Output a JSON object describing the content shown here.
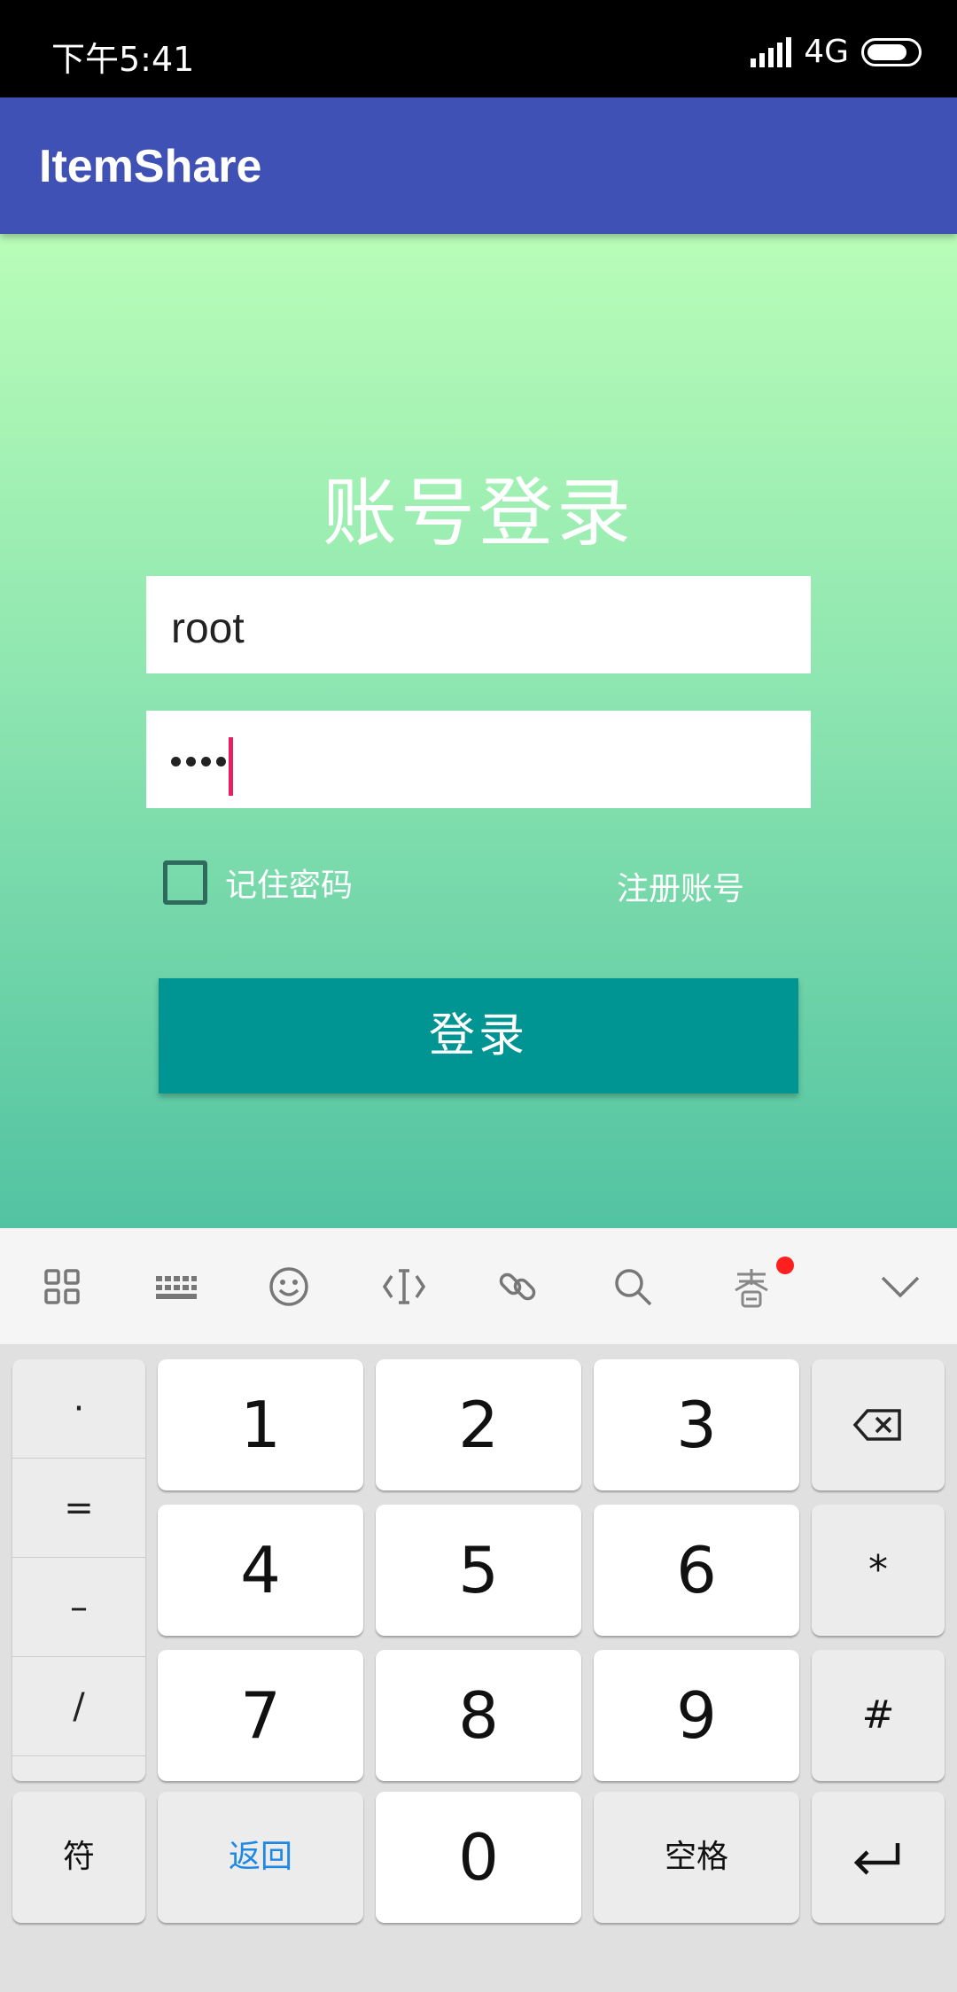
{
  "status_bar": {
    "time": "下午5:41",
    "network": "4G"
  },
  "app_bar": {
    "title": "ItemShare"
  },
  "login": {
    "heading": "账号登录",
    "username_value": "root",
    "password_mask_count": 4,
    "remember_label": "记住密码",
    "remember_checked": false,
    "register_label": "注册账号",
    "login_button": "登录"
  },
  "keyboard_toolbar": {
    "icons": [
      "grid-icon",
      "keyboard-icon",
      "emoji-icon",
      "cursor-icon",
      "link-icon",
      "search-icon",
      "festival-icon",
      "chevron-down-icon"
    ],
    "notification_dot": true
  },
  "keyboard": {
    "side_keys": [
      "·",
      "=",
      "–",
      "/"
    ],
    "row1": [
      "1",
      "2",
      "3"
    ],
    "row2": [
      "4",
      "5",
      "6"
    ],
    "row3": [
      "7",
      "8",
      "9"
    ],
    "star": "*",
    "hash": "#",
    "symbols_key": "符",
    "back_key": "返回",
    "zero": "0",
    "space_key": "空格",
    "accent_color": "#1e88e5"
  },
  "colors": {
    "app_bar": "#3f51b5",
    "login_button": "#009593",
    "cursor": "#e91e63"
  }
}
